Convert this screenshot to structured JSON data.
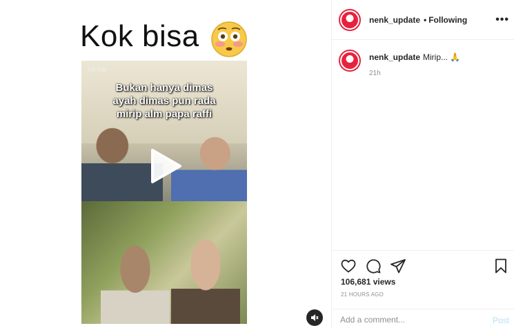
{
  "post": {
    "image_caption_text": "Kok bisa",
    "video_overlay_lines": [
      "Bukan hanya dimas",
      "ayah dimas pun rada",
      "mirip alm papa raffi"
    ],
    "watermark": "TikTok"
  },
  "header": {
    "username": "nenk_update",
    "separator": "•",
    "follow_status": "Following",
    "more_icon": "more-icon"
  },
  "caption": {
    "username": "nenk_update",
    "text": "Mirip... 🙏",
    "time": "21h"
  },
  "actions": {
    "icons": [
      "heart-icon",
      "comment-icon",
      "share-icon",
      "bookmark-icon"
    ],
    "views": "106,681 views",
    "timestamp": "21 HOURS AGO"
  },
  "comment_box": {
    "placeholder": "Add a comment...",
    "post_label": "Post"
  },
  "colors": {
    "link_disabled": "#b2dffc",
    "avatar_accent": "#e6233e",
    "muted_text": "#8e8e8e"
  }
}
